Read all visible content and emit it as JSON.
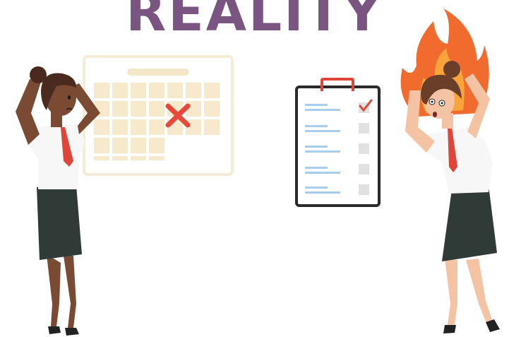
{
  "title": "REALITY",
  "colors": {
    "title": "#7b5582",
    "calendar_fill": "#f7e9cc",
    "calendar_border": "#f5ecd7",
    "cross": "#e8483a",
    "clipboard_border": "#2a2a2a",
    "clip": "#e0453a",
    "checklist_lines": "#a9cdea",
    "checkbox": "#e1e1e1",
    "check": "#e0453a",
    "skirt": "#303a36",
    "shirt": "#f7f7f7",
    "tie": "#e0453a",
    "fire_outer": "#f26b2e",
    "fire_inner": "#f9a43a"
  },
  "icons": {
    "calendar": "calendar-icon",
    "cross": "x-mark-icon",
    "clipboard": "clipboard-checklist-icon",
    "check": "checkmark-icon",
    "fire": "fire-icon"
  }
}
